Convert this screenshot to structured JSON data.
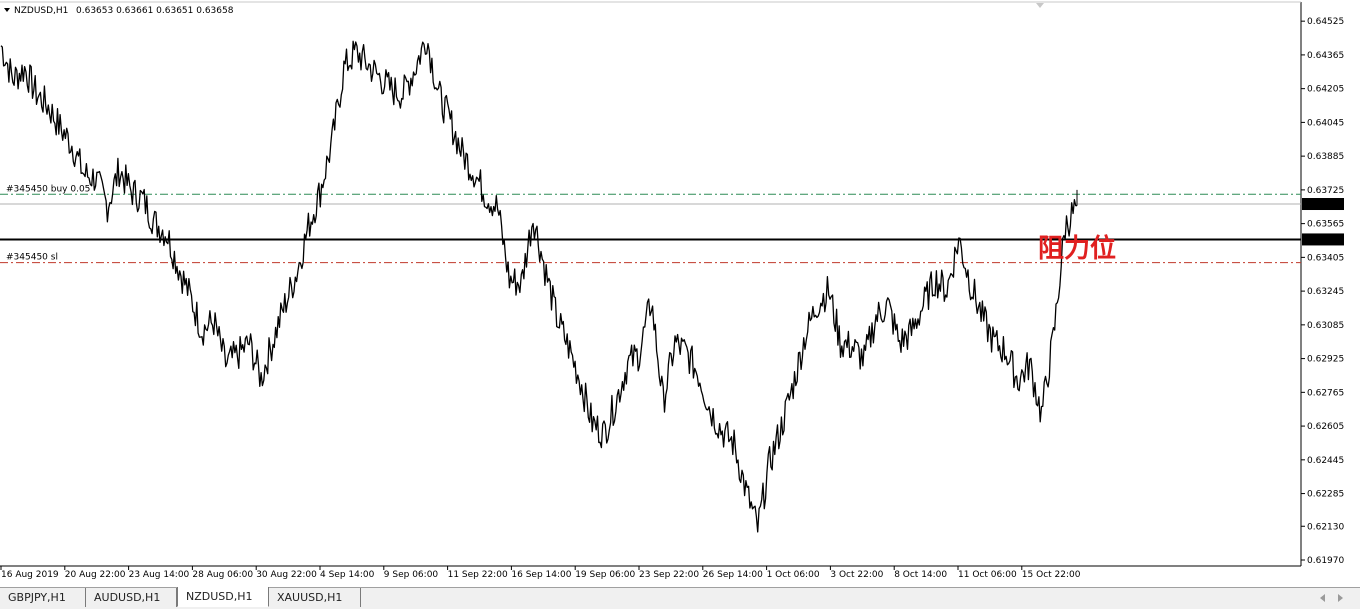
{
  "header": {
    "symbol_label": "NZDUSD,H1",
    "ohlc_label": "0.63653 0.63661 0.63651 0.63658"
  },
  "tabs": [
    {
      "label": "GBPJPY,H1",
      "active": false
    },
    {
      "label": "AUDUSD,H1",
      "active": false
    },
    {
      "label": "NZDUSD,H1",
      "active": true
    },
    {
      "label": "XAUUSD,H1",
      "active": false
    }
  ],
  "chart_data": {
    "type": "line",
    "title": "NZDUSD,H1",
    "ylim": [
      0.6197,
      0.6454
    ],
    "y_ticks": [
      "0.64525",
      "0.64365",
      "0.64205",
      "0.64045",
      "0.63885",
      "0.63725",
      "0.63565",
      "0.63405",
      "0.63245",
      "0.63085",
      "0.62925",
      "0.62765",
      "0.62605",
      "0.62445",
      "0.62285",
      "0.62130",
      "0.61970"
    ],
    "x_ticks": [
      "16 Aug 2019",
      "20 Aug 22:00",
      "23 Aug 14:00",
      "28 Aug 06:00",
      "30 Aug 22:00",
      "4 Sep 14:00",
      "9 Sep 06:00",
      "11 Sep 22:00",
      "16 Sep 14:00",
      "19 Sep 06:00",
      "23 Sep 22:00",
      "26 Sep 14:00",
      "1 Oct 06:00",
      "3 Oct 22:00",
      "8 Oct 14:00",
      "11 Oct 06:00",
      "15 Oct 22:00"
    ],
    "grid": false,
    "series": [
      {
        "values": [
          0.6441,
          0.6425,
          0.643,
          0.6418,
          0.6412,
          0.6402,
          0.6394,
          0.638,
          0.6378,
          0.6365,
          0.6382,
          0.6372,
          0.6368,
          0.6357,
          0.6352,
          0.6336,
          0.6322,
          0.6306,
          0.631,
          0.629,
          0.6294,
          0.63,
          0.6283,
          0.6301,
          0.6318,
          0.6333,
          0.6355,
          0.6372,
          0.6395,
          0.643,
          0.6438,
          0.6432,
          0.6426,
          0.642,
          0.6418,
          0.643,
          0.6445,
          0.6418,
          0.6405,
          0.639,
          0.6381,
          0.637,
          0.6364,
          0.633,
          0.6328,
          0.636,
          0.6335,
          0.6312,
          0.6298,
          0.6282,
          0.6262,
          0.6257,
          0.6272,
          0.629,
          0.6295,
          0.632,
          0.6272,
          0.63,
          0.6295,
          0.6285,
          0.6268,
          0.6258,
          0.6252,
          0.623,
          0.6212,
          0.6243,
          0.626,
          0.628,
          0.6303,
          0.6318,
          0.6325,
          0.63,
          0.6298,
          0.6292,
          0.6312,
          0.6318,
          0.63,
          0.6305,
          0.6318,
          0.633,
          0.6325,
          0.6349,
          0.6328,
          0.6312,
          0.63,
          0.6296,
          0.6282,
          0.629,
          0.6266,
          0.6302,
          0.6355,
          0.6365
        ]
      }
    ],
    "horizontal_lines": [
      {
        "label": "#345450 buy 0.05",
        "value": 0.63704,
        "style": "dash-dot",
        "color": "#2e8b57"
      },
      {
        "label": "",
        "value": 0.63658,
        "style": "solid",
        "color": "#b0b0b0",
        "price_tag": "0.63658"
      },
      {
        "label": "",
        "value": 0.6349,
        "style": "solid",
        "color": "#000000",
        "price_tag": "0.63490"
      },
      {
        "label": "#345450 sl",
        "value": 0.6338,
        "style": "dash-dot",
        "color": "#c0392b"
      }
    ],
    "annotation": {
      "text": "阻力位",
      "color": "#e02020",
      "anchor_value": 0.6349
    }
  }
}
